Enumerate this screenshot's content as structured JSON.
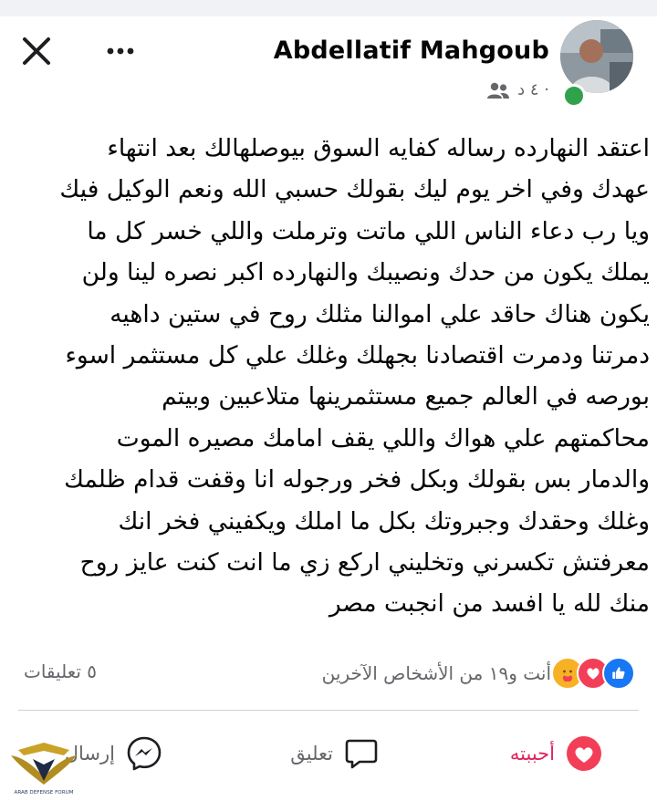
{
  "post": {
    "author": "Abdellatif Mahgoub",
    "time": "٤ د ·",
    "lines": [
      "اعتقد النهارده رساله كفايه السوق بيوصلهالك بعد انتهاء",
      "عهدك وفي اخر يوم ليك بقولك حسبي الله ونعم الوكيل فيك",
      "ويا رب دعاء الناس اللي ماتت وترملت واللي خسر كل ما",
      "يملك يكون من حدك ونصيبك والنهارده اكبر نصره لينا  ولن",
      "يكون هناك حاقد علي اموالنا مثلك روح في ستين داهيه",
      "دمرتنا ودمرت اقتصادنا بجهلك وغلك علي كل مستثمر اسوء",
      "بورصه في العالم جميع مستثمرينها متلاعبين  وبيتم",
      "محاكمتهم علي هواك  واللي يقف امامك مصيره الموت",
      "والدمار بس بقولك وبكل فخر ورجوله انا وقفت قدام ظلمك",
      "وغلك وحقدك وجبروتك بكل ما املك ويكفيني فخر انك",
      "معرفتش تكسرني وتخليني اركع زي ما انت كنت عايز روح",
      "منك لله يا افسد من انجبت مصر"
    ]
  },
  "reactions": {
    "summary": "أنت و١٩ من الأشخاص الآخرين"
  },
  "comments": {
    "count_label": "٥ تعليقات"
  },
  "actions": {
    "like": "أحببته",
    "comment": "تعليق",
    "send": "إرسال"
  },
  "watermark": {
    "text": "ARAB DEFENSE FORUM"
  },
  "colors": {
    "like": "#e0245e",
    "secondary": "#65676b",
    "online": "#31a24c",
    "facebook_blue": "#1877f2"
  }
}
